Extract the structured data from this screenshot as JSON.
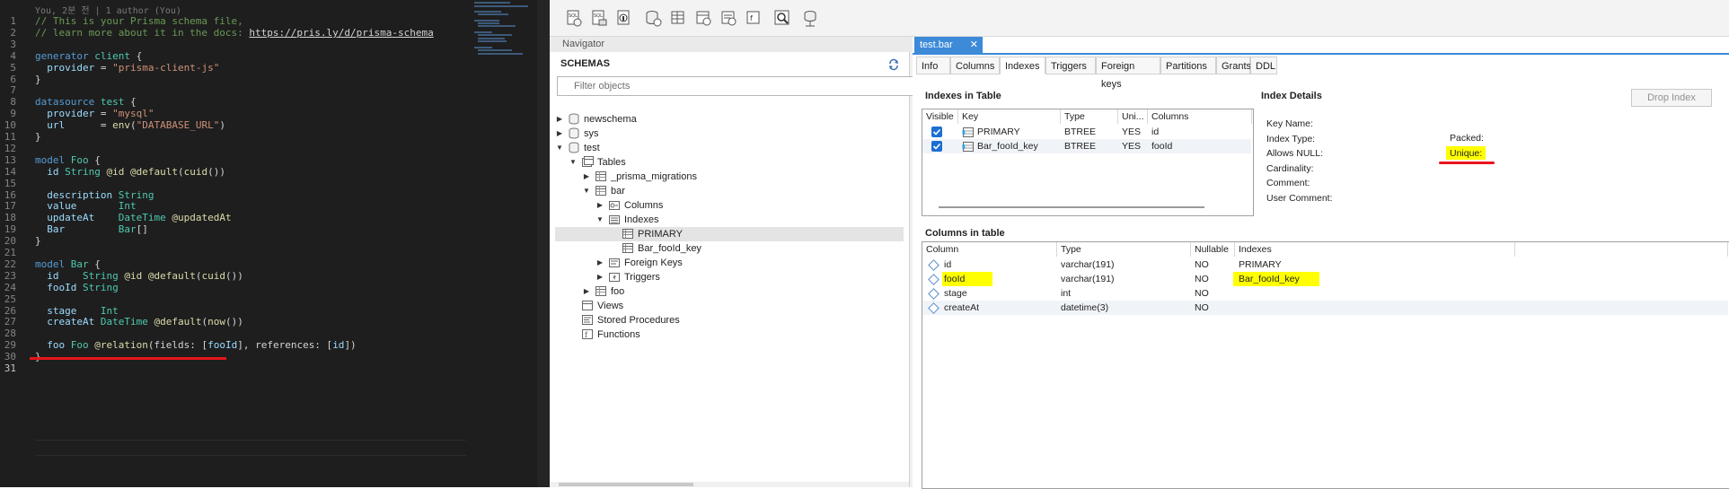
{
  "editor": {
    "blame": "You, 2분 전 | 1 author (You)",
    "lines": [
      [
        {
          "t": "// This is your Prisma schema file,",
          "c": "t-c"
        }
      ],
      [
        {
          "t": "// learn more about it in the docs: ",
          "c": "t-c"
        },
        {
          "t": "https://pris.ly/d/prisma-schema",
          "c": "t-u"
        }
      ],
      [],
      [
        {
          "t": "generator ",
          "c": "t-k"
        },
        {
          "t": "client",
          "c": "t-ty"
        },
        {
          "t": " {",
          "c": "t-w"
        }
      ],
      [
        {
          "t": "  provider",
          "c": "t-v"
        },
        {
          "t": " = ",
          "c": "t-w"
        },
        {
          "t": "\"prisma-client-js\"",
          "c": "t-s"
        }
      ],
      [
        {
          "t": "}",
          "c": "t-w"
        }
      ],
      [],
      [
        {
          "t": "datasource ",
          "c": "t-k"
        },
        {
          "t": "test",
          "c": "t-ty"
        },
        {
          "t": " {",
          "c": "t-w"
        }
      ],
      [
        {
          "t": "  provider",
          "c": "t-v"
        },
        {
          "t": " = ",
          "c": "t-w"
        },
        {
          "t": "\"mysql\"",
          "c": "t-s"
        }
      ],
      [
        {
          "t": "  url",
          "c": "t-v"
        },
        {
          "t": "      = ",
          "c": "t-w"
        },
        {
          "t": "env",
          "c": "t-f"
        },
        {
          "t": "(",
          "c": "t-w"
        },
        {
          "t": "\"DATABASE_URL\"",
          "c": "t-s"
        },
        {
          "t": ")",
          "c": "t-w"
        }
      ],
      [
        {
          "t": "}",
          "c": "t-w"
        }
      ],
      [],
      [
        {
          "t": "model ",
          "c": "t-k"
        },
        {
          "t": "Foo",
          "c": "t-ty"
        },
        {
          "t": " {",
          "c": "t-w"
        }
      ],
      [
        {
          "t": "  id",
          "c": "t-v"
        },
        {
          "t": " String",
          "c": "t-ty"
        },
        {
          "t": " @id @default",
          "c": "t-f"
        },
        {
          "t": "(",
          "c": "t-w"
        },
        {
          "t": "cuid",
          "c": "t-f"
        },
        {
          "t": "())",
          "c": "t-w"
        }
      ],
      [],
      [
        {
          "t": "  description",
          "c": "t-v"
        },
        {
          "t": " String",
          "c": "t-ty"
        }
      ],
      [
        {
          "t": "  value",
          "c": "t-v"
        },
        {
          "t": "       Int",
          "c": "t-ty"
        }
      ],
      [
        {
          "t": "  updateAt",
          "c": "t-v"
        },
        {
          "t": "    DateTime",
          "c": "t-ty"
        },
        {
          "t": " @updatedAt",
          "c": "t-f"
        }
      ],
      [
        {
          "t": "  Bar",
          "c": "t-v"
        },
        {
          "t": "         Bar",
          "c": "t-ty"
        },
        {
          "t": "[]",
          "c": "t-w"
        }
      ],
      [
        {
          "t": "}",
          "c": "t-w"
        }
      ],
      [],
      [
        {
          "t": "model ",
          "c": "t-k"
        },
        {
          "t": "Bar",
          "c": "t-ty"
        },
        {
          "t": " {",
          "c": "t-w"
        }
      ],
      [
        {
          "t": "  id",
          "c": "t-v"
        },
        {
          "t": "    String",
          "c": "t-ty"
        },
        {
          "t": " @id @default",
          "c": "t-f"
        },
        {
          "t": "(",
          "c": "t-w"
        },
        {
          "t": "cuid",
          "c": "t-f"
        },
        {
          "t": "())",
          "c": "t-w"
        }
      ],
      [
        {
          "t": "  fooId",
          "c": "t-v"
        },
        {
          "t": " String",
          "c": "t-ty"
        }
      ],
      [],
      [
        {
          "t": "  stage",
          "c": "t-v"
        },
        {
          "t": "    Int",
          "c": "t-ty"
        }
      ],
      [
        {
          "t": "  createAt",
          "c": "t-v"
        },
        {
          "t": " DateTime",
          "c": "t-ty"
        },
        {
          "t": " @default",
          "c": "t-f"
        },
        {
          "t": "(",
          "c": "t-w"
        },
        {
          "t": "now",
          "c": "t-f"
        },
        {
          "t": "())",
          "c": "t-w"
        }
      ],
      [],
      [
        {
          "t": "  foo",
          "c": "t-v"
        },
        {
          "t": " Foo",
          "c": "t-ty"
        },
        {
          "t": " @relation",
          "c": "t-f"
        },
        {
          "t": "(fields: [",
          "c": "t-w"
        },
        {
          "t": "fooId",
          "c": "t-v"
        },
        {
          "t": "], references: [",
          "c": "t-w"
        },
        {
          "t": "id",
          "c": "t-v"
        },
        {
          "t": "])",
          "c": "t-w"
        }
      ],
      [
        {
          "t": "}",
          "c": "t-w"
        }
      ],
      []
    ]
  },
  "navigator": {
    "header": "Navigator",
    "schemas_label": "SCHEMAS",
    "filter_placeholder": "Filter objects",
    "tree": [
      {
        "label": "newschema",
        "twisty": "▶",
        "icon": "database-icon",
        "indent": 0
      },
      {
        "label": "sys",
        "twisty": "▶",
        "icon": "database-icon",
        "indent": 0
      },
      {
        "label": "test",
        "twisty": "▼",
        "icon": "database-icon",
        "indent": 0
      },
      {
        "label": "Tables",
        "twisty": "▼",
        "icon": "tables-folder-icon",
        "indent": 1
      },
      {
        "label": "_prisma_migrations",
        "twisty": "▶",
        "icon": "table-icon",
        "indent": 2
      },
      {
        "label": "bar",
        "twisty": "▼",
        "icon": "table-icon",
        "indent": 2
      },
      {
        "label": "Columns",
        "twisty": "▶",
        "icon": "columns-folder-icon",
        "indent": 3
      },
      {
        "label": "Indexes",
        "twisty": "▼",
        "icon": "indexes-folder-icon",
        "indent": 3
      },
      {
        "label": "PRIMARY",
        "twisty": "",
        "icon": "index-icon",
        "indent": 4,
        "selected": true
      },
      {
        "label": "Bar_fooId_key",
        "twisty": "",
        "icon": "index-icon",
        "indent": 4
      },
      {
        "label": "Foreign Keys",
        "twisty": "▶",
        "icon": "foreign-keys-folder-icon",
        "indent": 3
      },
      {
        "label": "Triggers",
        "twisty": "▶",
        "icon": "triggers-folder-icon",
        "indent": 3
      },
      {
        "label": "foo",
        "twisty": "▶",
        "icon": "table-icon",
        "indent": 2
      },
      {
        "label": "Views",
        "twisty": "",
        "icon": "views-icon",
        "indent": 1
      },
      {
        "label": "Stored Procedures",
        "twisty": "",
        "icon": "stored-procedures-icon",
        "indent": 1
      },
      {
        "label": "Functions",
        "twisty": "",
        "icon": "functions-icon",
        "indent": 1
      }
    ]
  },
  "table_editor": {
    "doc_tab": "test.bar",
    "doc_tab_close": "✕",
    "subtabs": [
      "Info",
      "Columns",
      "Indexes",
      "Triggers",
      "Foreign keys",
      "Partitions",
      "Grants",
      "DDL"
    ],
    "active_subtab": "Indexes",
    "indexes_title": "Indexes in Table",
    "indexes_headers": [
      "Visible",
      "Key",
      "Type",
      "Uni...",
      "Columns"
    ],
    "indexes_rows": [
      {
        "visible": true,
        "key": "PRIMARY",
        "type": "BTREE",
        "unique": "YES",
        "columns": "id"
      },
      {
        "visible": true,
        "key": "Bar_fooId_key",
        "type": "BTREE",
        "unique": "YES",
        "columns": "fooId"
      }
    ],
    "details_title": "Index Details",
    "drop_button": "Drop Index",
    "details_left": [
      "Key Name:",
      "Index Type:",
      "Allows NULL:",
      "Cardinality:",
      "Comment:",
      "User Comment:"
    ],
    "details_right": [
      "Packed:",
      "Unique:"
    ],
    "columns_title": "Columns in table",
    "columns_headers": [
      "Column",
      "Type",
      "Nullable",
      "Indexes"
    ],
    "columns_rows": [
      {
        "column": "id",
        "type": "varchar(191)",
        "nullable": "NO",
        "indexes": "PRIMARY"
      },
      {
        "column": "fooId",
        "type": "varchar(191)",
        "nullable": "NO",
        "indexes": "Bar_fooId_key"
      },
      {
        "column": "stage",
        "type": "int",
        "nullable": "NO",
        "indexes": ""
      },
      {
        "column": "createAt",
        "type": "datetime(3)",
        "nullable": "NO",
        "indexes": ""
      }
    ]
  },
  "colors": {
    "highlight": "#ffff00",
    "annotation_red": "#e8141a",
    "tab_blue": "#3c8ad8"
  }
}
